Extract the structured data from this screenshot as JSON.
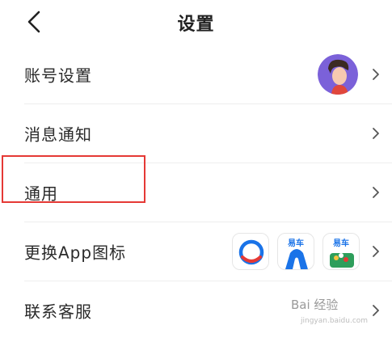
{
  "header": {
    "title": "设置"
  },
  "rows": [
    {
      "label": "账号设置"
    },
    {
      "label": "消息通知"
    },
    {
      "label": "通用"
    },
    {
      "label": "更换App图标"
    },
    {
      "label": "联系客服"
    }
  ],
  "app_icons": {
    "icon2_text": "易车",
    "icon3_text": "易车"
  },
  "watermark": {
    "text": "Bai 经验",
    "sub": "jingyan.baidu.com"
  },
  "colors": {
    "highlight": "#e53935",
    "brand": "#1a73e8",
    "avatar_bg": "#7b61d9"
  }
}
